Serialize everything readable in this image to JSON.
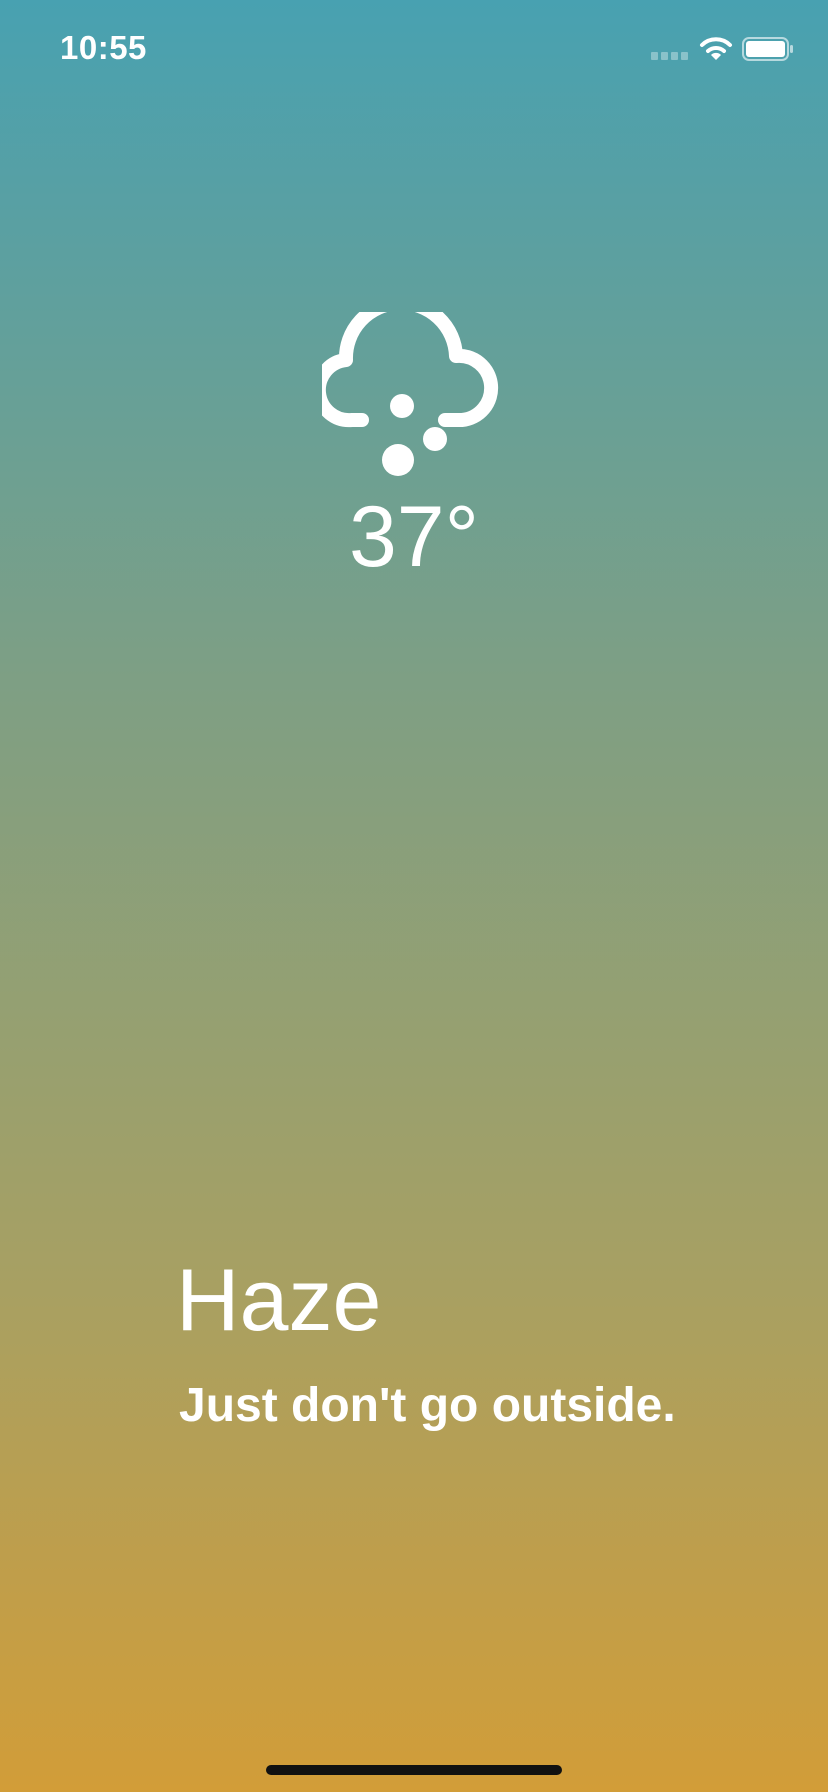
{
  "status_bar": {
    "time": "10:55",
    "signal_icon": "cellular-signal-icon",
    "wifi_icon": "wifi-icon",
    "battery_icon": "battery-icon"
  },
  "weather": {
    "icon": "hail-cloud-icon",
    "temperature": "37°",
    "condition": "Haze",
    "message": "Just don't go outside."
  },
  "theme": {
    "gradient_top": "#48a1b1",
    "gradient_bottom": "#d29d38",
    "text_color": "#ffffff"
  }
}
